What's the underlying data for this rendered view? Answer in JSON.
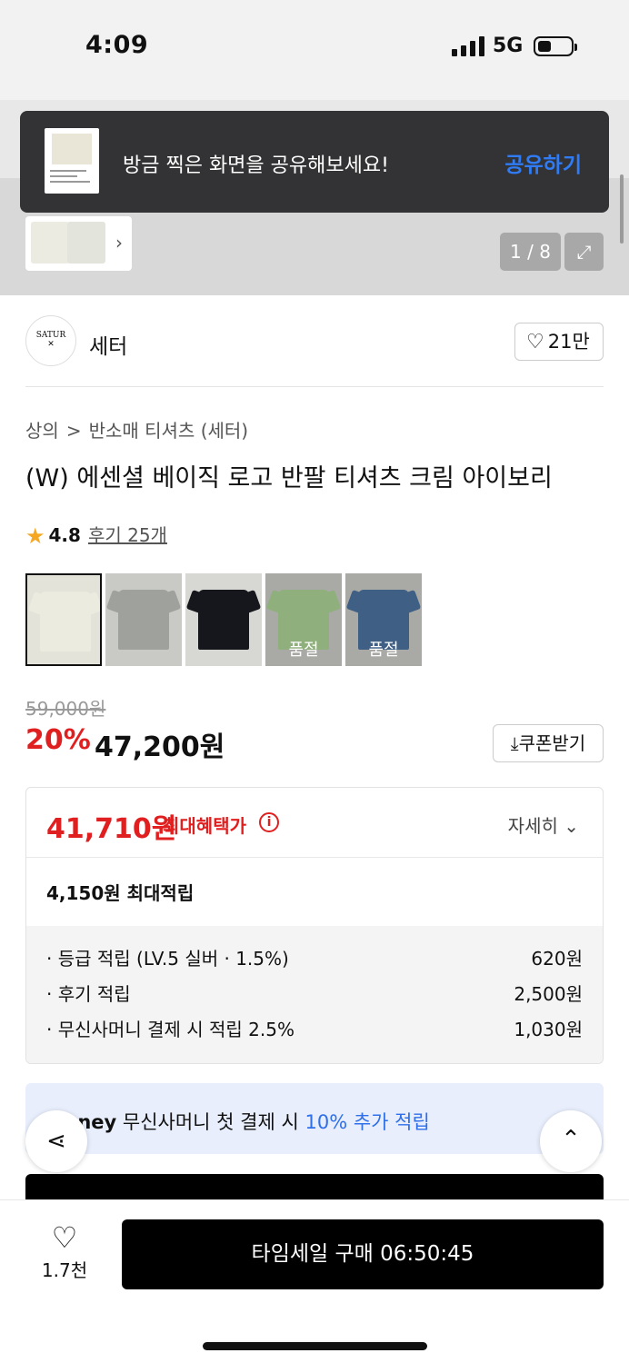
{
  "status_bar": {
    "time": "4:09",
    "network": "5G"
  },
  "toast": {
    "message": "방금 찍은 화면을 공유해보세요!",
    "action": "공유하기"
  },
  "gallery": {
    "pager": "1 / 8"
  },
  "brand": {
    "logo_text": "SATUR",
    "name": "세터",
    "likes": "21만"
  },
  "breadcrumb": {
    "category": "상의",
    "separator": ">",
    "subcategory": "반소매 티셔츠 (세터)"
  },
  "product": {
    "title": "(W) 에센셜 베이직 로고 반팔 티셔츠 크림 아이보리"
  },
  "rating": {
    "score": "4.8",
    "reviews": "후기 25개"
  },
  "options": [
    {
      "color": "#ecebdf",
      "bg": "#e4e3da",
      "soldout": ""
    },
    {
      "color": "#9ea19c",
      "bg": "#c9cac6",
      "soldout": ""
    },
    {
      "color": "#15171c",
      "bg": "#d7d7d3",
      "soldout": ""
    },
    {
      "color": "#8fb07c",
      "bg": "#a9a9a5",
      "soldout": "품절"
    },
    {
      "color": "#3f5f85",
      "bg": "#a9a9a5",
      "soldout": "품절"
    }
  ],
  "price": {
    "original": "59,000원",
    "discount": "20%",
    "sale": "47,200원",
    "coupon_label": "쿠폰받기"
  },
  "benefit": {
    "max_price": "41,710원",
    "max_label": "최대혜택가",
    "detail_label": "자세히",
    "points_summary": "4,150원 최대적립",
    "rows": [
      {
        "label": "· 등급 적립 (LV.5 실버 · 1.5%)",
        "amount": "620원"
      },
      {
        "label": "· 후기 적립",
        "amount": "2,500원"
      },
      {
        "label": "· 무신사머니 결제 시 적립 2.5%",
        "amount": "1,030원"
      }
    ]
  },
  "money_banner": {
    "brand": "Money",
    "text": "무신사머니 첫 결제 시",
    "highlight": "10% 추가 적립"
  },
  "bottom_bar": {
    "wish_count": "1.7천",
    "buy_label": "타임세일 구매 06:50:45"
  },
  "colors": {
    "accent_red": "#e02020",
    "link_blue": "#2f7cf6",
    "banner_bg": "#e8eefc"
  }
}
